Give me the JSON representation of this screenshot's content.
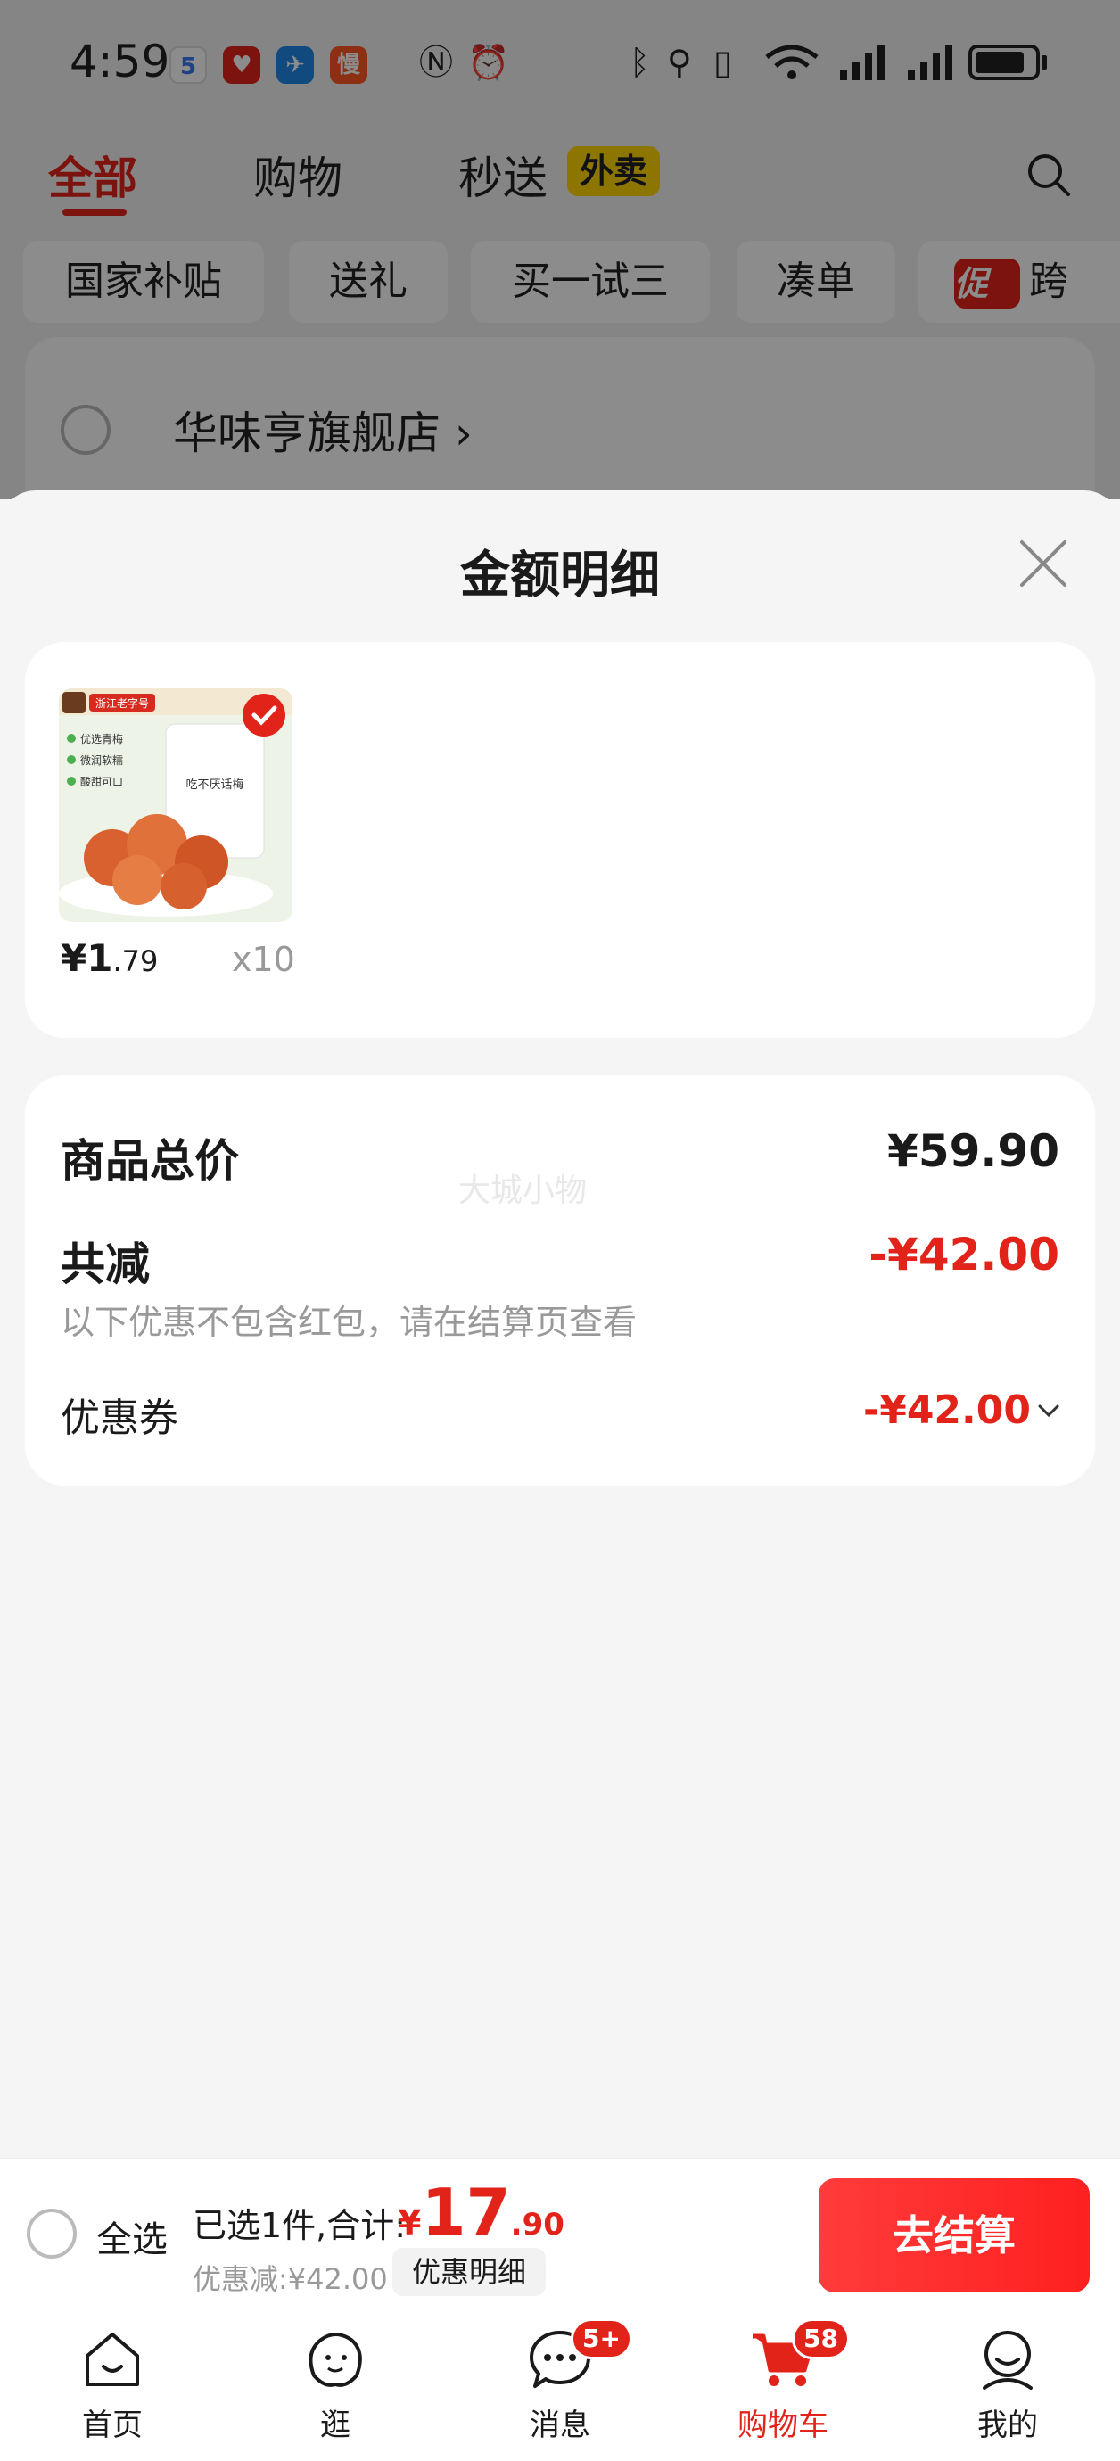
{
  "status_bar": {
    "time": "4:59",
    "app_icons": [
      "5",
      "♥",
      "✈",
      "慢"
    ],
    "colors": {
      "app_1": "#3a78f2",
      "app_2": "#e2231a",
      "app_3": "#1e88e5",
      "app_4": "#ff5722"
    }
  },
  "top_tabs": {
    "items": [
      "全部",
      "购物",
      "秒送"
    ],
    "badge": "外卖"
  },
  "chips": [
    "国家补贴",
    "送礼",
    "买一试三",
    "凑单",
    "跨"
  ],
  "promo_tag": "促",
  "store": {
    "name": "华味亨旗舰店"
  },
  "sheet": {
    "title": "金额明细",
    "product": {
      "price_symbol": "¥",
      "price_int": "1",
      "price_dec": ".79",
      "qty": "x10",
      "image_texts": [
        "浙江老字号",
        "优选青梅",
        "微润软糯",
        "酸甜可口",
        "吃不厌话梅"
      ]
    },
    "summary": {
      "total_label": "商品总价",
      "total_value": "¥59.90",
      "discount_label": "共减",
      "discount_value": "-¥42.00",
      "note": "以下优惠不包含红包，请在结算页查看",
      "coupon_label": "优惠券",
      "coupon_value": "-¥42.00",
      "watermark": "大城小物"
    }
  },
  "checkout": {
    "select_all": "全选",
    "selected_text": "已选1件,合计:",
    "total_currency": "¥",
    "total_int": "17",
    "total_dec": ".90",
    "discount_text": "优惠减:¥42.00",
    "detail_button": "优惠明细",
    "checkout_button": "去结算"
  },
  "bottom_nav": {
    "items": [
      {
        "label": "首页",
        "icon": "home-icon"
      },
      {
        "label": "逛",
        "icon": "browse-icon"
      },
      {
        "label": "消息",
        "icon": "message-icon",
        "badge": "5+"
      },
      {
        "label": "购物车",
        "icon": "cart-icon",
        "badge": "58"
      },
      {
        "label": "我的",
        "icon": "profile-icon"
      }
    ],
    "active": "购物车"
  },
  "colors": {
    "accent": "#e2231a",
    "badge_yellow": "#ffd500",
    "muted": "#999999"
  }
}
